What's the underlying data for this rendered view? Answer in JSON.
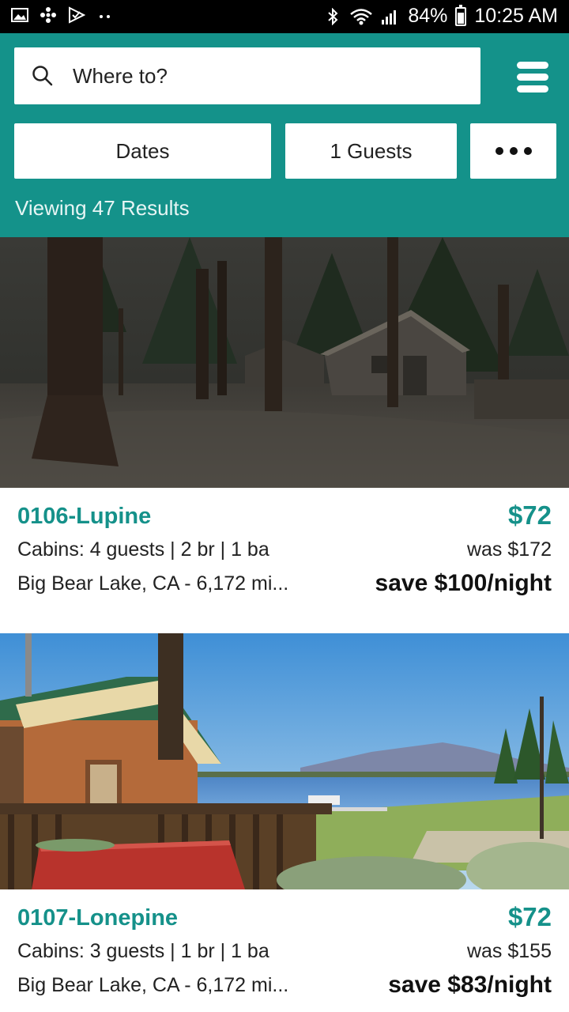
{
  "status_bar": {
    "battery": "84%",
    "time": "10:25 AM"
  },
  "search": {
    "placeholder": "Where to?"
  },
  "filters": {
    "dates_label": "Dates",
    "guests_label": "1 Guests"
  },
  "results": {
    "label": "Viewing 47 Results"
  },
  "colors": {
    "accent": "#14928a",
    "status_bar": "#000000"
  },
  "icons": {
    "search": "search-icon",
    "menu": "hamburger-menu-icon",
    "more": "more-dots-icon"
  },
  "listings": [
    {
      "name": "0106-Lupine",
      "details": "Cabins: 4 guests | 2 br | 1 ba",
      "location": "Big Bear Lake, CA - 6,172 mi...",
      "price": "$72",
      "was": "was $172",
      "save": "save $100/night"
    },
    {
      "name": "0107-Lonepine",
      "details": "Cabins: 3 guests | 1 br | 1 ba",
      "location": "Big Bear Lake, CA - 6,172 mi...",
      "price": "$72",
      "was": "was $155",
      "save": "save $83/night"
    }
  ]
}
